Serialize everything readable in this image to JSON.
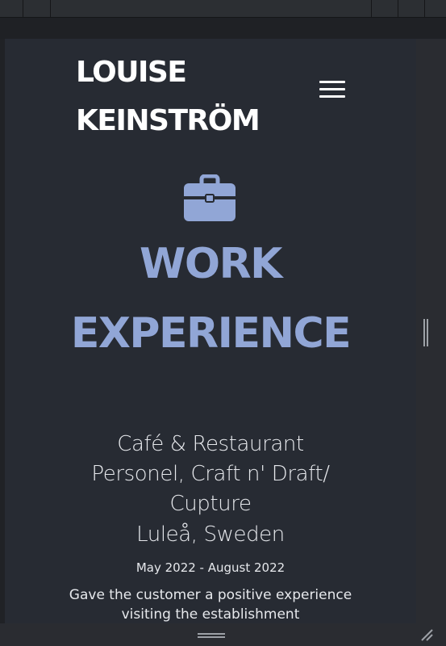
{
  "header": {
    "name_line1": "LOUISE",
    "name_line2": "KEINSTRÖM",
    "menu_icon": "hamburger-menu-icon"
  },
  "section": {
    "icon": "briefcase-icon",
    "title_line1": "WORK",
    "title_line2": "EXPERIENCE"
  },
  "job": {
    "title_line1": "Café & Restaurant",
    "title_line2": "Personel, Craft n' Draft/",
    "title_line3": "Cupture",
    "location": "Luleå, Sweden",
    "dates": "May 2022 - August 2022",
    "description": "Gave the customer a positive experience visiting the establishment"
  },
  "colors": {
    "page_background": "#272b33",
    "accent": "#91a6d6",
    "text": "#e6e8ec",
    "brand": "#ffffff"
  }
}
